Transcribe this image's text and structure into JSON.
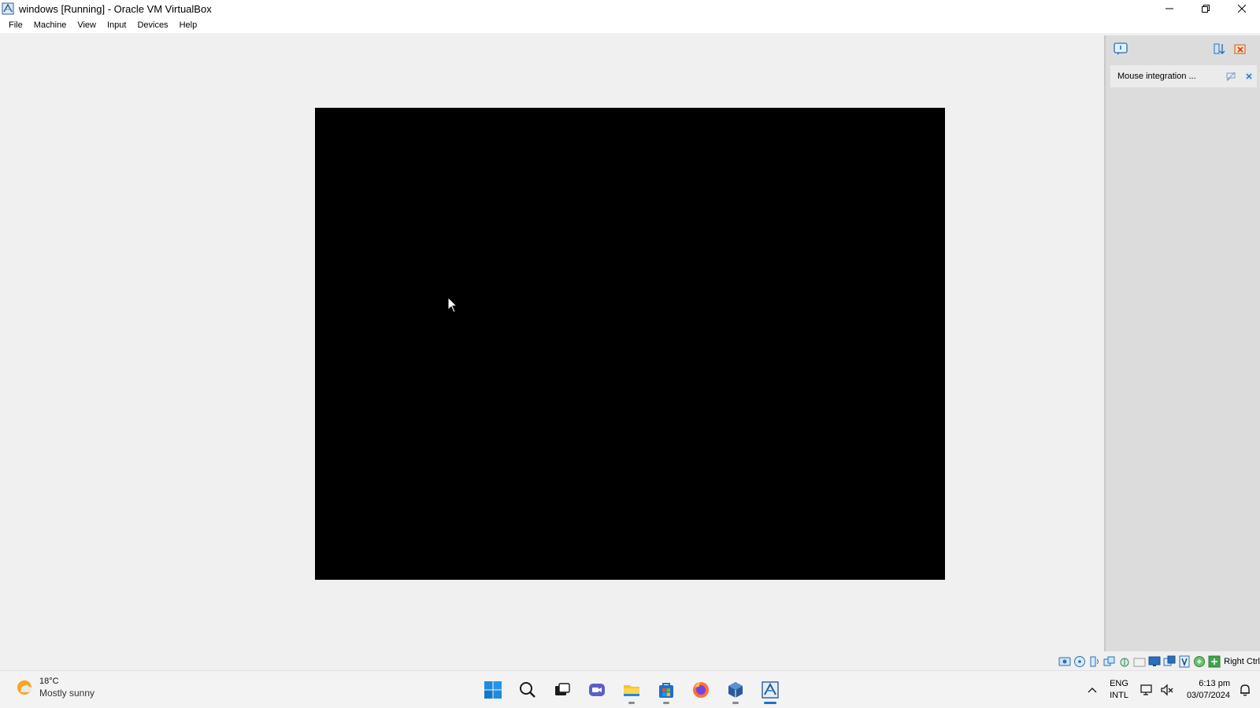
{
  "window": {
    "title": "windows  [Running] - Oracle VM VirtualBox"
  },
  "menu": [
    "File",
    "Machine",
    "View",
    "Input",
    "Devices",
    "Help"
  ],
  "notification_panel": {
    "item_label": "Mouse integration ..."
  },
  "statusbar": {
    "host_key": "Right Ctrl",
    "icons": [
      "hard-disk-icon",
      "optical-drive-icon",
      "audio-icon",
      "network-icon",
      "usb-icon",
      "shared-folders-icon",
      "display-icon",
      "recording-icon",
      "cpu-icon",
      "mouse-integration-icon",
      "keyboard-icon"
    ]
  },
  "taskbar": {
    "weather": {
      "temp": "18°C",
      "condition": "Mostly sunny"
    },
    "apps": [
      "start-icon",
      "search-icon",
      "task-view-icon",
      "meet-icon",
      "file-explorer-icon",
      "store-icon",
      "firefox-icon",
      "virtualbox-icon",
      "virtualbox-vm-icon"
    ],
    "language": {
      "line1": "ENG",
      "line2": "INTL"
    },
    "clock": {
      "time": "6:13 pm",
      "date": "03/07/2024"
    }
  },
  "colors": {
    "accent": "#1a73c8",
    "vm_screen": "#000000",
    "panel": "#dcdcdc"
  }
}
